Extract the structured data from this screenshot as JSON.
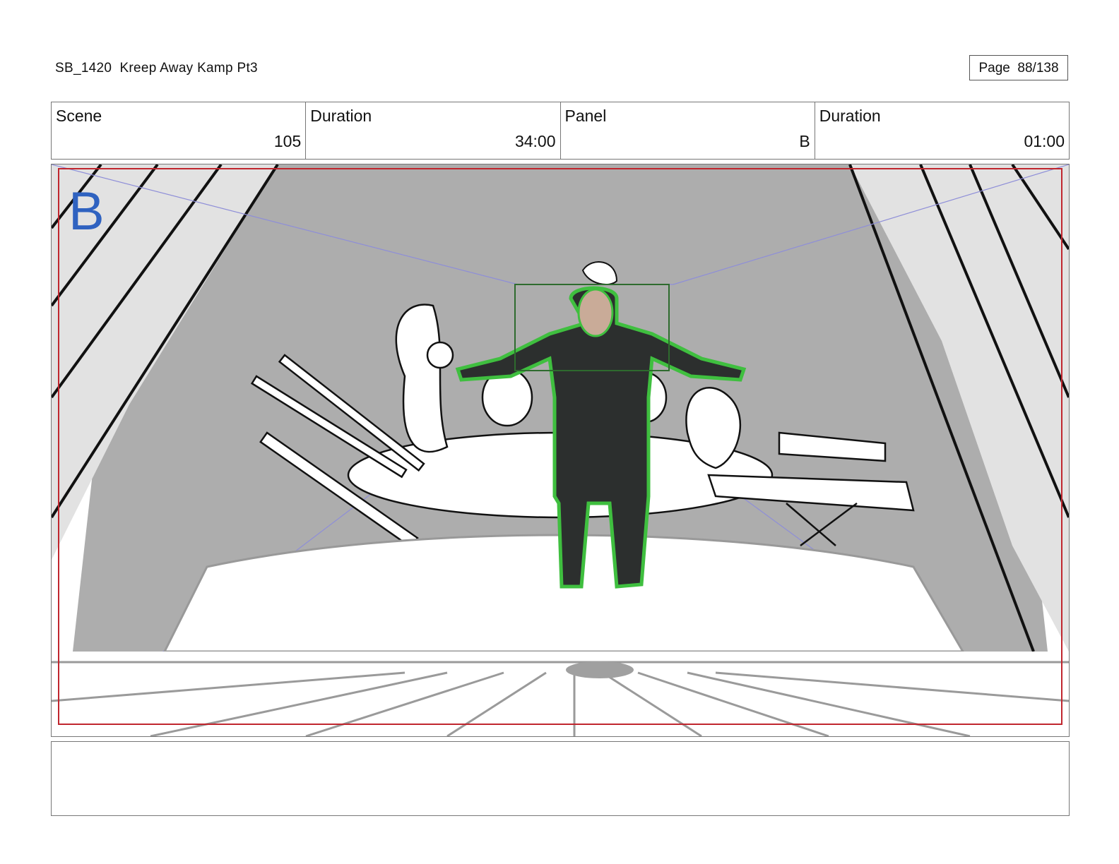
{
  "header": {
    "title": "SB_1420  Kreep Away Kamp Pt3",
    "page_label": "Page  88/138"
  },
  "info": {
    "scene_label": "Scene",
    "scene_value": "105",
    "scene_duration_label": "Duration",
    "scene_duration_value": "34:00",
    "panel_label": "Panel",
    "panel_value": "B",
    "panel_duration_label": "Duration",
    "panel_duration_value": "01:00"
  },
  "panel": {
    "letter": "B",
    "letter_color": "#2f62c0",
    "safe_frame_color": "#c0262e",
    "focus_box_color": "#2e6b2e",
    "character_highlight_color": "#3fbf3f"
  },
  "notes": {
    "text": ""
  }
}
